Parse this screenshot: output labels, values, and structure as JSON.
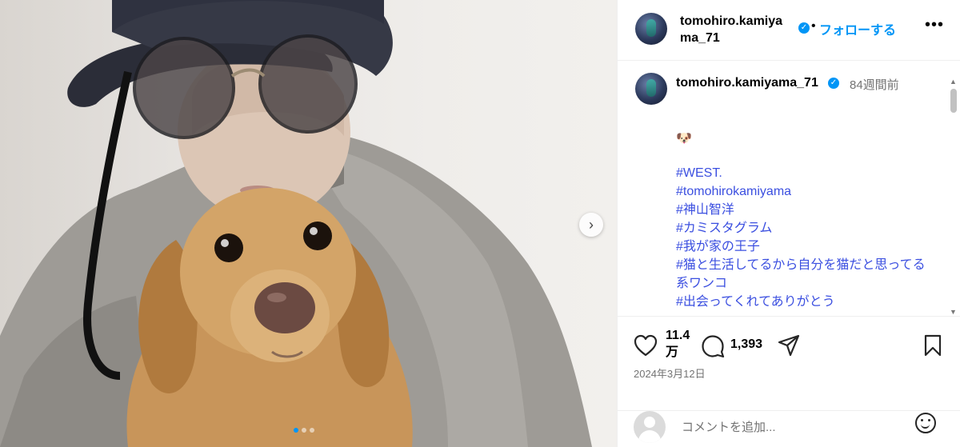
{
  "header": {
    "username": "tomohiro.kamiyama_71",
    "follow_label": "フォローする",
    "separator": "•",
    "more_label": "•••"
  },
  "caption": {
    "username": "tomohiro.kamiyama_71",
    "time_ago": "84週間前",
    "emoji": "🐶",
    "hashtags": [
      "#WEST.",
      "#tomohirokamiyama",
      "#神山智洋",
      "#カミスタグラム",
      "#我が家の王子",
      "#猫と生活してるから自分を猫だと思ってる系ワンコ",
      "#出会ってくれてありがとう"
    ]
  },
  "stats": {
    "likes": "11.4万",
    "comments": "1,393",
    "date": "2024年3月12日"
  },
  "comment_box": {
    "placeholder": "コメントを追加..."
  },
  "carousel": {
    "next_label": "›",
    "slide_count": 3,
    "active_slide": 1
  },
  "colors": {
    "accent": "#0095f6",
    "hashtag": "#3b4fe0",
    "secondary_text": "#737373"
  }
}
